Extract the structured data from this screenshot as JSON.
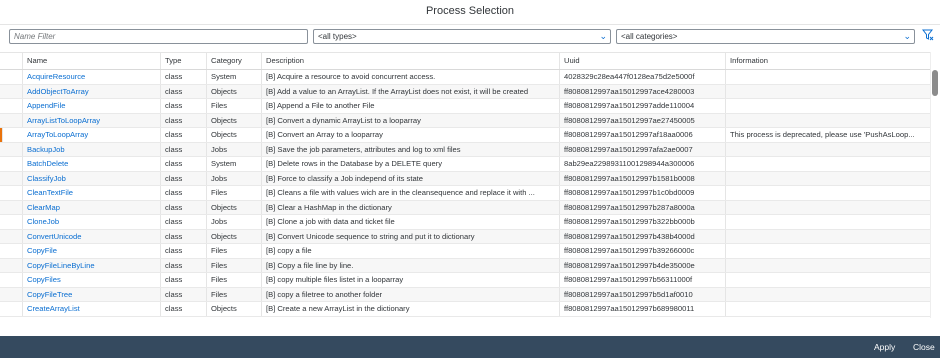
{
  "dialog": {
    "title": "Process Selection"
  },
  "filters": {
    "name_placeholder": "Name Filter",
    "types_value": "<all types>",
    "categories_value": "<all categories>"
  },
  "table": {
    "headers": {
      "name": "Name",
      "type": "Type",
      "category": "Category",
      "description": "Description",
      "uuid": "Uuid",
      "information": "Information"
    },
    "rows": [
      {
        "name": "AcquireResource",
        "type": "class",
        "category": "System",
        "description": "[B] Acquire a resource to avoid concurrent access.",
        "uuid": "4028329c28ea447f0128ea75d2e5000f",
        "information": "",
        "marked": false
      },
      {
        "name": "AddObjectToArray",
        "type": "class",
        "category": "Objects",
        "description": "[B] Add a value to an ArrayList. If the ArrayList does not exist, it will be created",
        "uuid": "ff8080812997aa15012997ace4280003",
        "information": "",
        "marked": false
      },
      {
        "name": "AppendFile",
        "type": "class",
        "category": "Files",
        "description": "[B] Append a File to another File",
        "uuid": "ff8080812997aa15012997adde110004",
        "information": "",
        "marked": false
      },
      {
        "name": "ArrayListToLoopArray",
        "type": "class",
        "category": "Objects",
        "description": "[B] Convert a dynamic ArrayList to a looparray",
        "uuid": "ff8080812997aa15012997ae27450005",
        "information": "",
        "marked": false
      },
      {
        "name": "ArrayToLoopArray",
        "type": "class",
        "category": "Objects",
        "description": "[B] Convert an Array to a looparray",
        "uuid": "ff8080812997aa15012997af18aa0006",
        "information": "This process is deprecated, please use 'PushAsLoop...",
        "marked": true
      },
      {
        "name": "BackupJob",
        "type": "class",
        "category": "Jobs",
        "description": "[B] Save the job parameters, attributes and log to xml files",
        "uuid": "ff8080812997aa15012997afa2ae0007",
        "information": "",
        "marked": false
      },
      {
        "name": "BatchDelete",
        "type": "class",
        "category": "System",
        "description": "[B] Delete rows in the Database by a DELETE query",
        "uuid": "8ab29ea22989311001298944a300006",
        "information": "",
        "marked": false
      },
      {
        "name": "ClassifyJob",
        "type": "class",
        "category": "Jobs",
        "description": "[B] Force to classify a Job independ of its state",
        "uuid": "ff8080812997aa15012997b1581b0008",
        "information": "",
        "marked": false
      },
      {
        "name": "CleanTextFile",
        "type": "class",
        "category": "Files",
        "description": "[B] Cleans a file with values wich are in the cleansequence and replace it with ...",
        "uuid": "ff8080812997aa15012997b1c0bd0009",
        "information": "",
        "marked": false
      },
      {
        "name": "ClearMap",
        "type": "class",
        "category": "Objects",
        "description": "[B] Clear a HashMap in the dictionary",
        "uuid": "ff8080812997aa15012997b287a8000a",
        "information": "",
        "marked": false
      },
      {
        "name": "CloneJob",
        "type": "class",
        "category": "Jobs",
        "description": "[B] Clone a job with data and ticket file",
        "uuid": "ff8080812997aa15012997b322bb000b",
        "information": "",
        "marked": false
      },
      {
        "name": "ConvertUnicode",
        "type": "class",
        "category": "Objects",
        "description": "[B] Convert Unicode sequence to string and put it to dictionary",
        "uuid": "ff8080812997aa15012997b438b4000d",
        "information": "",
        "marked": false
      },
      {
        "name": "CopyFile",
        "type": "class",
        "category": "Files",
        "description": "[B] copy a file",
        "uuid": "ff8080812997aa15012997b39266000c",
        "information": "",
        "marked": false
      },
      {
        "name": "CopyFileLineByLine",
        "type": "class",
        "category": "Files",
        "description": "[B] Copy a file line by line.",
        "uuid": "ff8080812997aa15012997b4de35000e",
        "information": "",
        "marked": false
      },
      {
        "name": "CopyFiles",
        "type": "class",
        "category": "Files",
        "description": "[B] copy multiple files listet in a looparray",
        "uuid": "ff8080812997aa15012997b56311000f",
        "information": "",
        "marked": false
      },
      {
        "name": "CopyFileTree",
        "type": "class",
        "category": "Files",
        "description": "[B] copy a filetree to another folder",
        "uuid": "ff8080812997aa15012997b5d1af0010",
        "information": "",
        "marked": false
      },
      {
        "name": "CreateArrayList",
        "type": "class",
        "category": "Objects",
        "description": "[B] Create a new ArrayList in the dictionary",
        "uuid": "ff8080812997aa15012997b689980011",
        "information": "",
        "marked": false
      }
    ]
  },
  "footer": {
    "apply_label": "Apply",
    "close_label": "Close"
  },
  "icons": {
    "dropdown": "chevron-down-icon",
    "filter_clear": "filter-clear-icon"
  },
  "colors": {
    "footer_bg": "#354a5f",
    "link": "#0a6ed1",
    "marker": "#e9730c"
  }
}
